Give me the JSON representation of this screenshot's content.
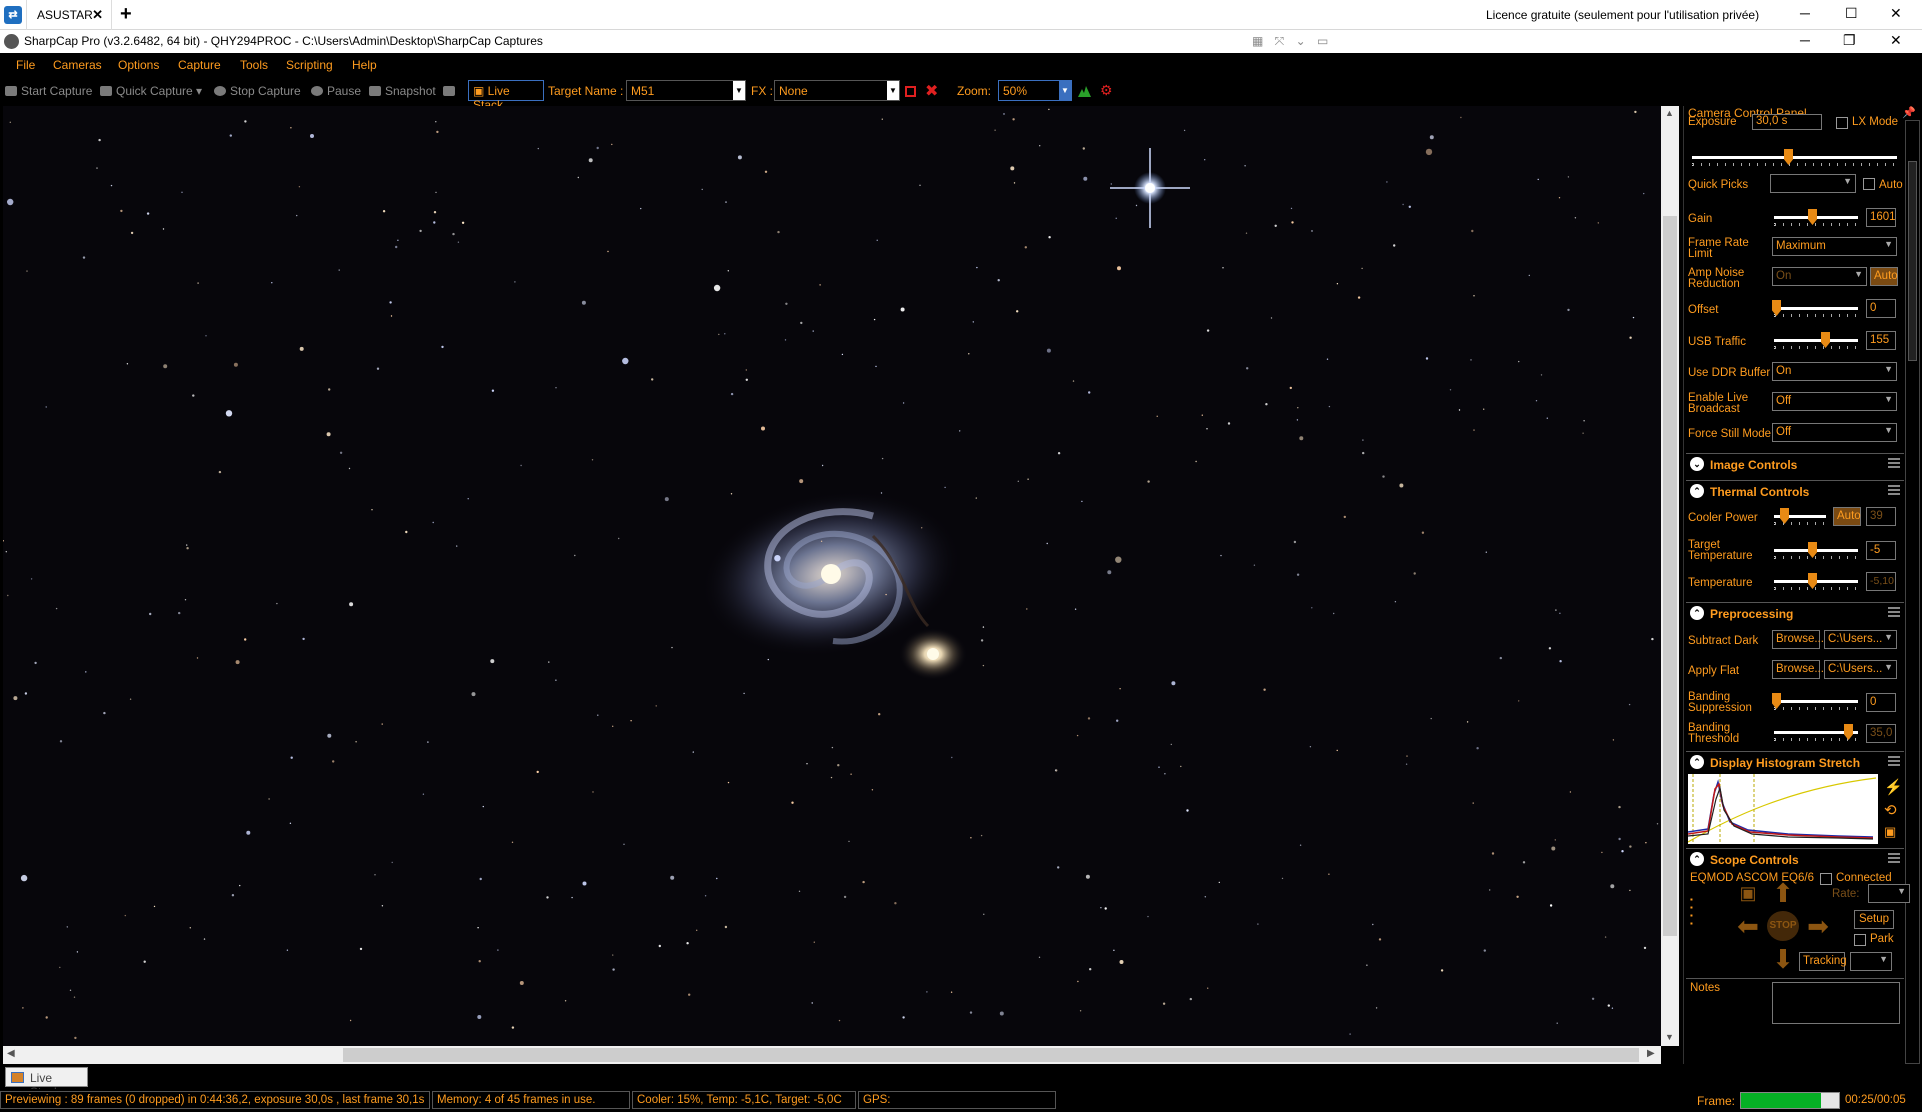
{
  "remote": {
    "tab_label": "ASUSTAR",
    "licence": "Licence gratuite (seulement pour l'utilisation privée)"
  },
  "app": {
    "title": "SharpCap Pro (v3.2.6482, 64 bit) - QHY294PROC - C:\\Users\\Admin\\Desktop\\SharpCap Captures"
  },
  "menu": [
    "File",
    "Cameras",
    "Options",
    "Capture",
    "Tools",
    "Scripting",
    "Help"
  ],
  "toolbar": {
    "start_capture": "Start Capture",
    "quick_capture": "Quick Capture",
    "stop_capture": "Stop Capture",
    "pause": "Pause",
    "snapshot": "Snapshot",
    "live_stack": "Live Stack",
    "target_name_label": "Target Name :",
    "target_name_value": "M51",
    "fx_label": "FX :",
    "fx_value": "None",
    "zoom_label": "Zoom:",
    "zoom_value": "50%"
  },
  "bottom_tab": "Live Stack",
  "status": {
    "previewing": "Previewing : 89 frames (0 dropped) in 0:44:36,2, exposure 30,0s , last frame 30,1s",
    "memory": "Memory: 4 of 45 frames in use.",
    "cooler": "Cooler: 15%, Temp: -5,1C, Target: -5,0C",
    "gps": "GPS:",
    "frame_label": "Frame:",
    "frame_progress": 0.82,
    "time": "00:25/00:05"
  },
  "panel": {
    "title": "Camera Control Panel",
    "exposure_label": "Exposure",
    "exposure_value": "30,0 s",
    "lx_mode": "LX Mode",
    "quick_picks": "Quick Picks",
    "auto": "Auto",
    "gain_label": "Gain",
    "gain_value": "1601",
    "frame_rate_label": "Frame Rate Limit",
    "frame_rate_value": "Maximum",
    "amp_noise_label": "Amp Noise Reduction",
    "amp_noise_value": "On",
    "offset_label": "Offset",
    "offset_value": "0",
    "usb_label": "USB Traffic",
    "usb_value": "155",
    "ddr_label": "Use DDR Buffer",
    "ddr_value": "On",
    "broadcast_label": "Enable Live Broadcast",
    "broadcast_value": "Off",
    "still_label": "Force Still Mode",
    "still_value": "Off",
    "image_controls": "Image Controls",
    "thermal_controls": "Thermal Controls",
    "cooler_power_label": "Cooler Power",
    "cooler_power_value": "39",
    "target_temp_label": "Target Temperature",
    "target_temp_value": "-5",
    "temperature_label": "Temperature",
    "temperature_value": "-5,10",
    "preprocessing": "Preprocessing",
    "subtract_dark_label": "Subtract Dark",
    "apply_flat_label": "Apply Flat",
    "browse": "Browse...",
    "path": "C:\\Users...",
    "banding_supp_label": "Banding Suppression",
    "banding_supp_value": "0",
    "banding_thr_label": "Banding Threshold",
    "banding_thr_value": "35,0",
    "display_hist": "Display Histogram Stretch",
    "scope_controls": "Scope Controls",
    "scope_name": "EQMOD ASCOM EQ6/6",
    "connected": "Connected",
    "rate": "Rate:",
    "setup": "Setup",
    "park": "Park",
    "stop": "STOP",
    "tracking": "Tracking",
    "notes": "Notes"
  }
}
